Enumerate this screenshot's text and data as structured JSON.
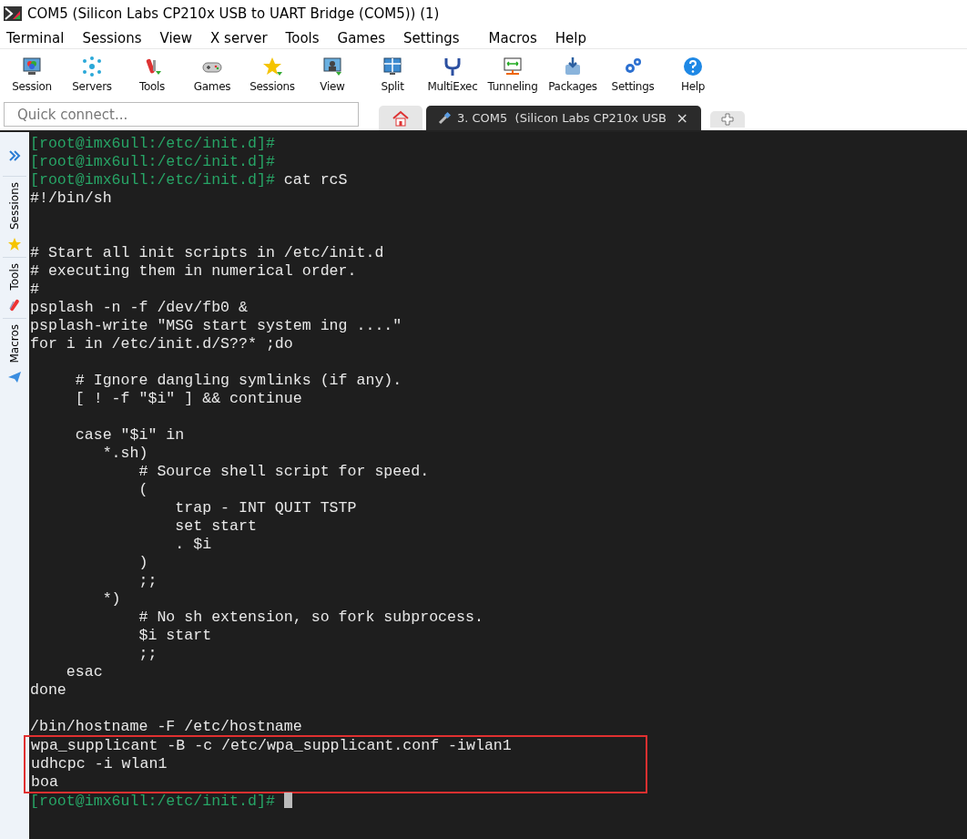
{
  "window": {
    "title": "COM5  (Silicon Labs CP210x USB to UART Bridge (COM5)) (1)"
  },
  "menu": [
    "Terminal",
    "Sessions",
    "View",
    "X server",
    "Tools",
    "Games",
    "Settings",
    "Macros",
    "Help"
  ],
  "toolbar": [
    "Session",
    "Servers",
    "Tools",
    "Games",
    "Sessions",
    "View",
    "Split",
    "MultiExec",
    "Tunneling",
    "Packages",
    "Settings",
    "Help"
  ],
  "quick_connect": {
    "placeholder": "Quick connect..."
  },
  "tabs": [
    {
      "kind": "home",
      "selected": false
    },
    {
      "kind": "session",
      "label": "3. COM5  (Silicon Labs CP210x USB",
      "close": "×",
      "selected": true
    },
    {
      "kind": "new",
      "selected": false
    }
  ],
  "sidebar": {
    "tabs": [
      "Sessions",
      "Tools",
      "Macros"
    ]
  },
  "terminal": {
    "blocks": [
      {
        "kind": "plain",
        "lines": [
          {
            "kind": "prompt",
            "prompt": "[root@imx6ull:/etc/init.d]#"
          },
          {
            "kind": "prompt",
            "prompt": "[root@imx6ull:/etc/init.d]#"
          },
          {
            "kind": "prompt",
            "prompt": "[root@imx6ull:/etc/init.d]#",
            "text": " cat rcS"
          },
          {
            "kind": "output",
            "text": "#!/bin/sh"
          },
          {
            "kind": "blank"
          },
          {
            "kind": "blank"
          },
          {
            "kind": "output",
            "text": "# Start all init scripts in /etc/init.d"
          },
          {
            "kind": "output",
            "text": "# executing them in numerical order."
          },
          {
            "kind": "output",
            "text": "#"
          },
          {
            "kind": "output",
            "text": "psplash -n -f /dev/fb0 &"
          },
          {
            "kind": "output",
            "text": "psplash-write \"MSG start system ing ....\""
          },
          {
            "kind": "output",
            "text": "for i in /etc/init.d/S??* ;do"
          },
          {
            "kind": "blank"
          },
          {
            "kind": "output",
            "text": "     # Ignore dangling symlinks (if any)."
          },
          {
            "kind": "output",
            "text": "     [ ! -f \"$i\" ] && continue"
          },
          {
            "kind": "blank"
          },
          {
            "kind": "output",
            "text": "     case \"$i\" in"
          },
          {
            "kind": "output",
            "text": "        *.sh)"
          },
          {
            "kind": "output",
            "text": "            # Source shell script for speed."
          },
          {
            "kind": "output",
            "text": "            ("
          },
          {
            "kind": "output",
            "text": "                trap - INT QUIT TSTP"
          },
          {
            "kind": "output",
            "text": "                set start"
          },
          {
            "kind": "output",
            "text": "                . $i"
          },
          {
            "kind": "output",
            "text": "            )"
          },
          {
            "kind": "output",
            "text": "            ;;"
          },
          {
            "kind": "output",
            "text": "        *)"
          },
          {
            "kind": "output",
            "text": "            # No sh extension, so fork subprocess."
          },
          {
            "kind": "output",
            "text": "            $i start"
          },
          {
            "kind": "output",
            "text": "            ;;"
          },
          {
            "kind": "output",
            "text": "    esac"
          },
          {
            "kind": "output",
            "text": "done"
          },
          {
            "kind": "blank"
          },
          {
            "kind": "output",
            "text": "/bin/hostname -F /etc/hostname"
          }
        ]
      },
      {
        "kind": "highlighted",
        "lines": [
          {
            "kind": "output",
            "text": "wpa_supplicant -B -c /etc/wpa_supplicant.conf -iwlan1"
          },
          {
            "kind": "output",
            "text": "udhcpc -i wlan1"
          },
          {
            "kind": "output",
            "text": "boa"
          }
        ]
      },
      {
        "kind": "plain",
        "lines": [
          {
            "kind": "prompt",
            "prompt": "[root@imx6ull:/etc/init.d]#",
            "cursor": true
          }
        ]
      }
    ]
  }
}
